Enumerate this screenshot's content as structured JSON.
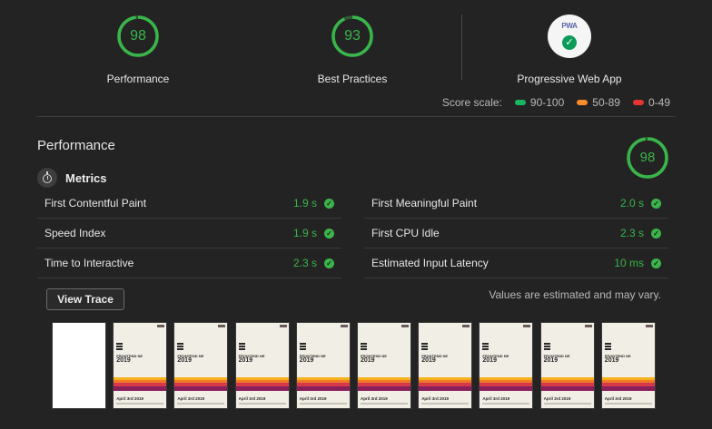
{
  "categories": [
    {
      "label": "Performance",
      "score": "98",
      "score_value": 98
    },
    {
      "label": "Best Practices",
      "score": "93",
      "score_value": 93
    },
    {
      "label": "Progressive Web App",
      "badge_text": "PWA",
      "badge_icon": "check-icon"
    }
  ],
  "score_scale": {
    "label": "Score scale:",
    "items": [
      {
        "label": "90-100",
        "color": "#18b663"
      },
      {
        "label": "50-89",
        "color": "#fb8c2d"
      },
      {
        "label": "0-49",
        "color": "#e43530"
      }
    ]
  },
  "performance": {
    "title": "Performance",
    "score": "98",
    "score_value": 98,
    "metrics_title": "Metrics",
    "metrics": [
      {
        "name": "First Contentful Paint",
        "value": "1.9 s"
      },
      {
        "name": "First Meaningful Paint",
        "value": "2.0 s"
      },
      {
        "name": "Speed Index",
        "value": "1.9 s"
      },
      {
        "name": "First CPU Idle",
        "value": "2.3 s"
      },
      {
        "name": "Time to Interactive",
        "value": "2.3 s"
      },
      {
        "name": "Estimated Input Latency",
        "value": "10 ms"
      }
    ],
    "view_trace_label": "View Trace",
    "note": "Values are estimated and may vary."
  },
  "filmstrip": {
    "frames": [
      {
        "blank": true
      },
      {
        "blank": false,
        "title": "FRONTEND NE",
        "year": "2019",
        "date": "April 3rd 2019"
      },
      {
        "blank": false,
        "title": "FRONTEND NE",
        "year": "2019",
        "date": "April 3rd 2019"
      },
      {
        "blank": false,
        "title": "FRONTEND NE",
        "year": "2019",
        "date": "April 3rd 2019"
      },
      {
        "blank": false,
        "title": "FRONTEND NE",
        "year": "2019",
        "date": "April 3rd 2019"
      },
      {
        "blank": false,
        "title": "FRONTEND NE",
        "year": "2019",
        "date": "April 3rd 2019"
      },
      {
        "blank": false,
        "title": "FRONTEND NE",
        "year": "2019",
        "date": "April 3rd 2019"
      },
      {
        "blank": false,
        "title": "FRONTEND NE",
        "year": "2019",
        "date": "April 3rd 2019"
      },
      {
        "blank": false,
        "title": "FRONTEND NE",
        "year": "2019",
        "date": "April 3rd 2019"
      },
      {
        "blank": false,
        "title": "FRONTEND NE",
        "year": "2019",
        "date": "April 3rd 2019"
      }
    ]
  },
  "colors": {
    "background": "#232323",
    "pass_green": "#3ab54a",
    "gauge_track": "#2e5a35"
  }
}
